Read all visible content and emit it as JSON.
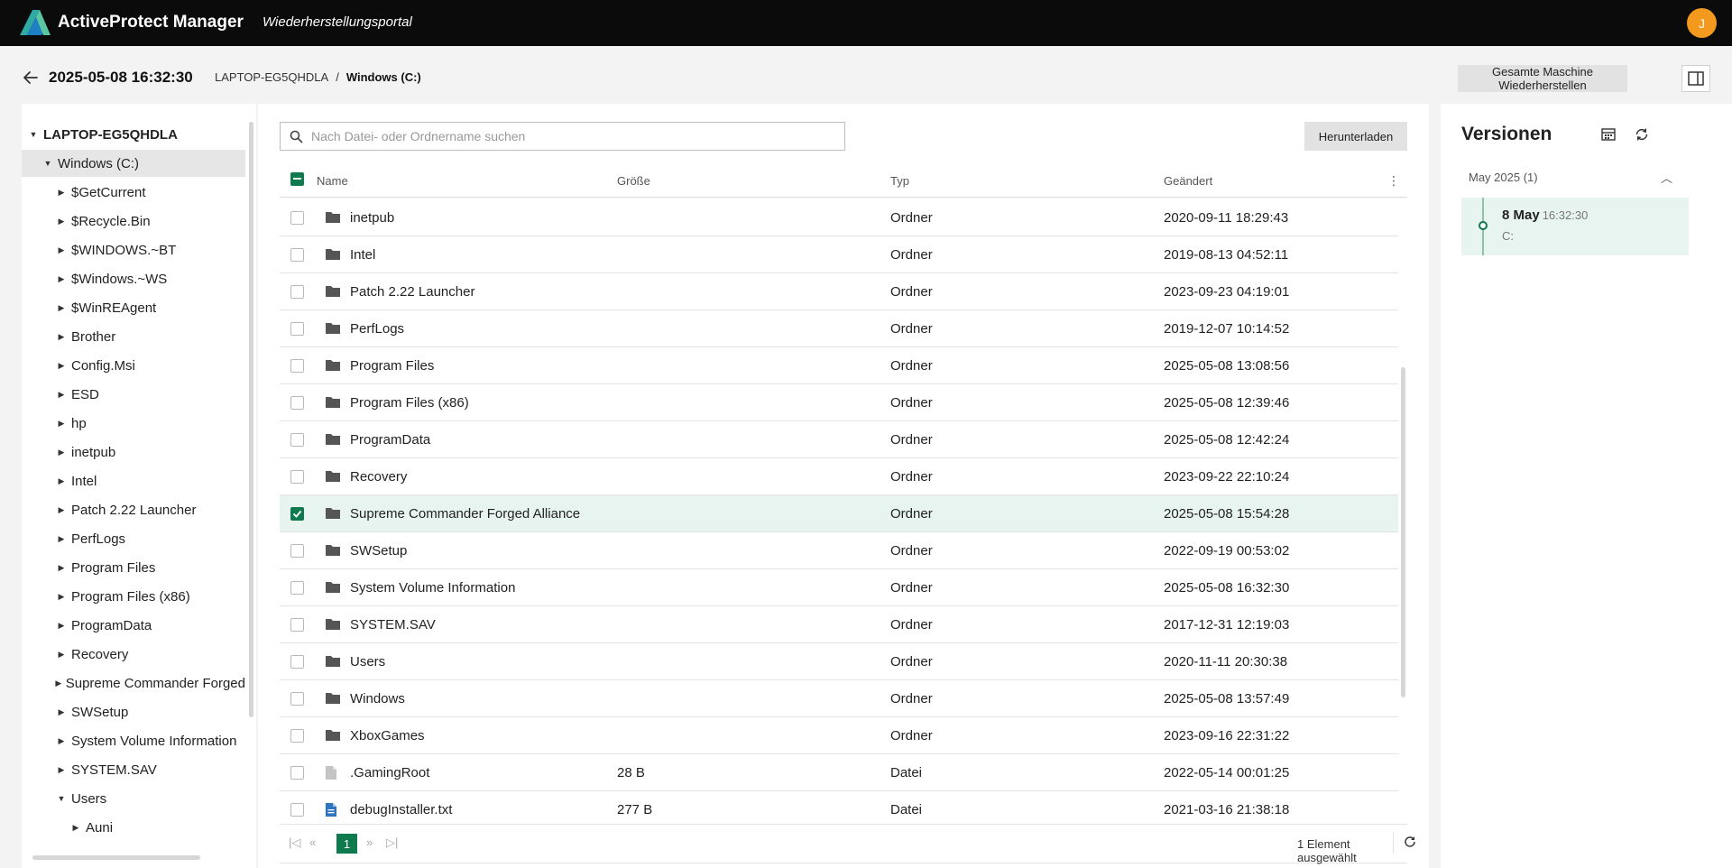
{
  "app": {
    "title": "ActiveProtect Manager",
    "subtitle": "Wiederherstellungsportal",
    "user_initial": "J",
    "accent_color": "#0e7a4e",
    "avatar_color": "#f39a1e"
  },
  "header": {
    "snapshot_time": "2025-05-08 16:32:30",
    "breadcrumb": [
      "LAPTOP-EG5QHDLA",
      "Windows (C:)"
    ],
    "breadcrumb_sep": "/",
    "restore_all_label": "Gesamte Maschine Wiederherstellen"
  },
  "tree": {
    "root": "LAPTOP-EG5QHDLA",
    "drive": "Windows (C:)",
    "items": [
      "$GetCurrent",
      "$Recycle.Bin",
      "$WINDOWS.~BT",
      "$Windows.~WS",
      "$WinREAgent",
      "Brother",
      "Config.Msi",
      "ESD",
      "hp",
      "inetpub",
      "Intel",
      "Patch 2.22 Launcher",
      "PerfLogs",
      "Program Files",
      "Program Files (x86)",
      "ProgramData",
      "Recovery",
      "Supreme Commander Forged",
      "SWSetup",
      "System Volume Information",
      "SYSTEM.SAV",
      "Users"
    ],
    "child_of_users": "Auni"
  },
  "toolbar": {
    "search_placeholder": "Nach Datei- oder Ordnername suchen",
    "download_label": "Herunterladen"
  },
  "table": {
    "columns": [
      "Name",
      "Größe",
      "Typ",
      "Geändert"
    ],
    "rows": [
      {
        "name": "inetpub",
        "size": "",
        "type": "Ordner",
        "modified": "2020-09-11 18:29:43",
        "kind": "folder",
        "checked": false
      },
      {
        "name": "Intel",
        "size": "",
        "type": "Ordner",
        "modified": "2019-08-13 04:52:11",
        "kind": "folder",
        "checked": false
      },
      {
        "name": "Patch 2.22 Launcher",
        "size": "",
        "type": "Ordner",
        "modified": "2023-09-23 04:19:01",
        "kind": "folder",
        "checked": false
      },
      {
        "name": "PerfLogs",
        "size": "",
        "type": "Ordner",
        "modified": "2019-12-07 10:14:52",
        "kind": "folder",
        "checked": false
      },
      {
        "name": "Program Files",
        "size": "",
        "type": "Ordner",
        "modified": "2025-05-08 13:08:56",
        "kind": "folder",
        "checked": false
      },
      {
        "name": "Program Files (x86)",
        "size": "",
        "type": "Ordner",
        "modified": "2025-05-08 12:39:46",
        "kind": "folder",
        "checked": false
      },
      {
        "name": "ProgramData",
        "size": "",
        "type": "Ordner",
        "modified": "2025-05-08 12:42:24",
        "kind": "folder",
        "checked": false
      },
      {
        "name": "Recovery",
        "size": "",
        "type": "Ordner",
        "modified": "2023-09-22 22:10:24",
        "kind": "folder",
        "checked": false
      },
      {
        "name": "Supreme Commander Forged Alliance",
        "size": "",
        "type": "Ordner",
        "modified": "2025-05-08 15:54:28",
        "kind": "folder",
        "checked": true
      },
      {
        "name": "SWSetup",
        "size": "",
        "type": "Ordner",
        "modified": "2022-09-19 00:53:02",
        "kind": "folder",
        "checked": false
      },
      {
        "name": "System Volume Information",
        "size": "",
        "type": "Ordner",
        "modified": "2025-05-08 16:32:30",
        "kind": "folder",
        "checked": false
      },
      {
        "name": "SYSTEM.SAV",
        "size": "",
        "type": "Ordner",
        "modified": "2017-12-31 12:19:03",
        "kind": "folder",
        "checked": false
      },
      {
        "name": "Users",
        "size": "",
        "type": "Ordner",
        "modified": "2020-11-11 20:30:38",
        "kind": "folder",
        "checked": false
      },
      {
        "name": "Windows",
        "size": "",
        "type": "Ordner",
        "modified": "2025-05-08 13:57:49",
        "kind": "folder",
        "checked": false
      },
      {
        "name": "XboxGames",
        "size": "",
        "type": "Ordner",
        "modified": "2023-09-16 22:31:22",
        "kind": "folder",
        "checked": false
      },
      {
        "name": ".GamingRoot",
        "size": "28 B",
        "type": "Datei",
        "modified": "2022-05-14 00:01:25",
        "kind": "file",
        "checked": false
      },
      {
        "name": "debugInstaller.txt",
        "size": "277 B",
        "type": "Datei",
        "modified": "2021-03-16 21:38:18",
        "kind": "textfile",
        "checked": false
      }
    ]
  },
  "pager": {
    "current_page": "1",
    "selection_text": "1 Element ausgewählt"
  },
  "versions": {
    "title": "Versionen",
    "group_label": "May 2025 (1)",
    "item_date": "8 May",
    "item_time": "16:32:30",
    "item_drive": "C:"
  }
}
